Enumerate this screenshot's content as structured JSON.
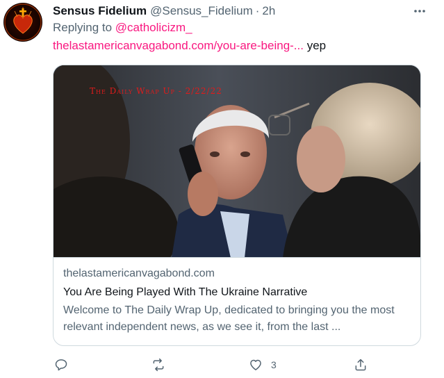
{
  "tweet": {
    "author_name": "Sensus Fidelium",
    "author_handle": "@Sensus_Fidelium",
    "separator": "·",
    "time": "2h",
    "more_glyph": "•••",
    "replying_prefix": "Replying to",
    "replying_to": "@catholicizm_",
    "link_text": "thelastamericanvagabond.com/you-are-being-...",
    "text_after_link": " yep"
  },
  "card": {
    "image_overlay_title": "The Daily Wrap Up - 2/22/22",
    "domain": "thelastamericanvagabond.com",
    "title": "You Are Being Played With The Ukraine Narrative",
    "description": "Welcome to The Daily Wrap Up, dedicated to bringing you the most relevant independent news, as we see it, from the last ..."
  },
  "actions": {
    "reply_icon": "reply-icon",
    "retweet_icon": "retweet-icon",
    "like_icon": "heart-icon",
    "like_count": "3",
    "share_icon": "share-icon"
  },
  "colors": {
    "accent": "#f91880",
    "secondary_text": "#536471",
    "border": "#cfd9de",
    "overlay_red": "#e01b1b"
  }
}
